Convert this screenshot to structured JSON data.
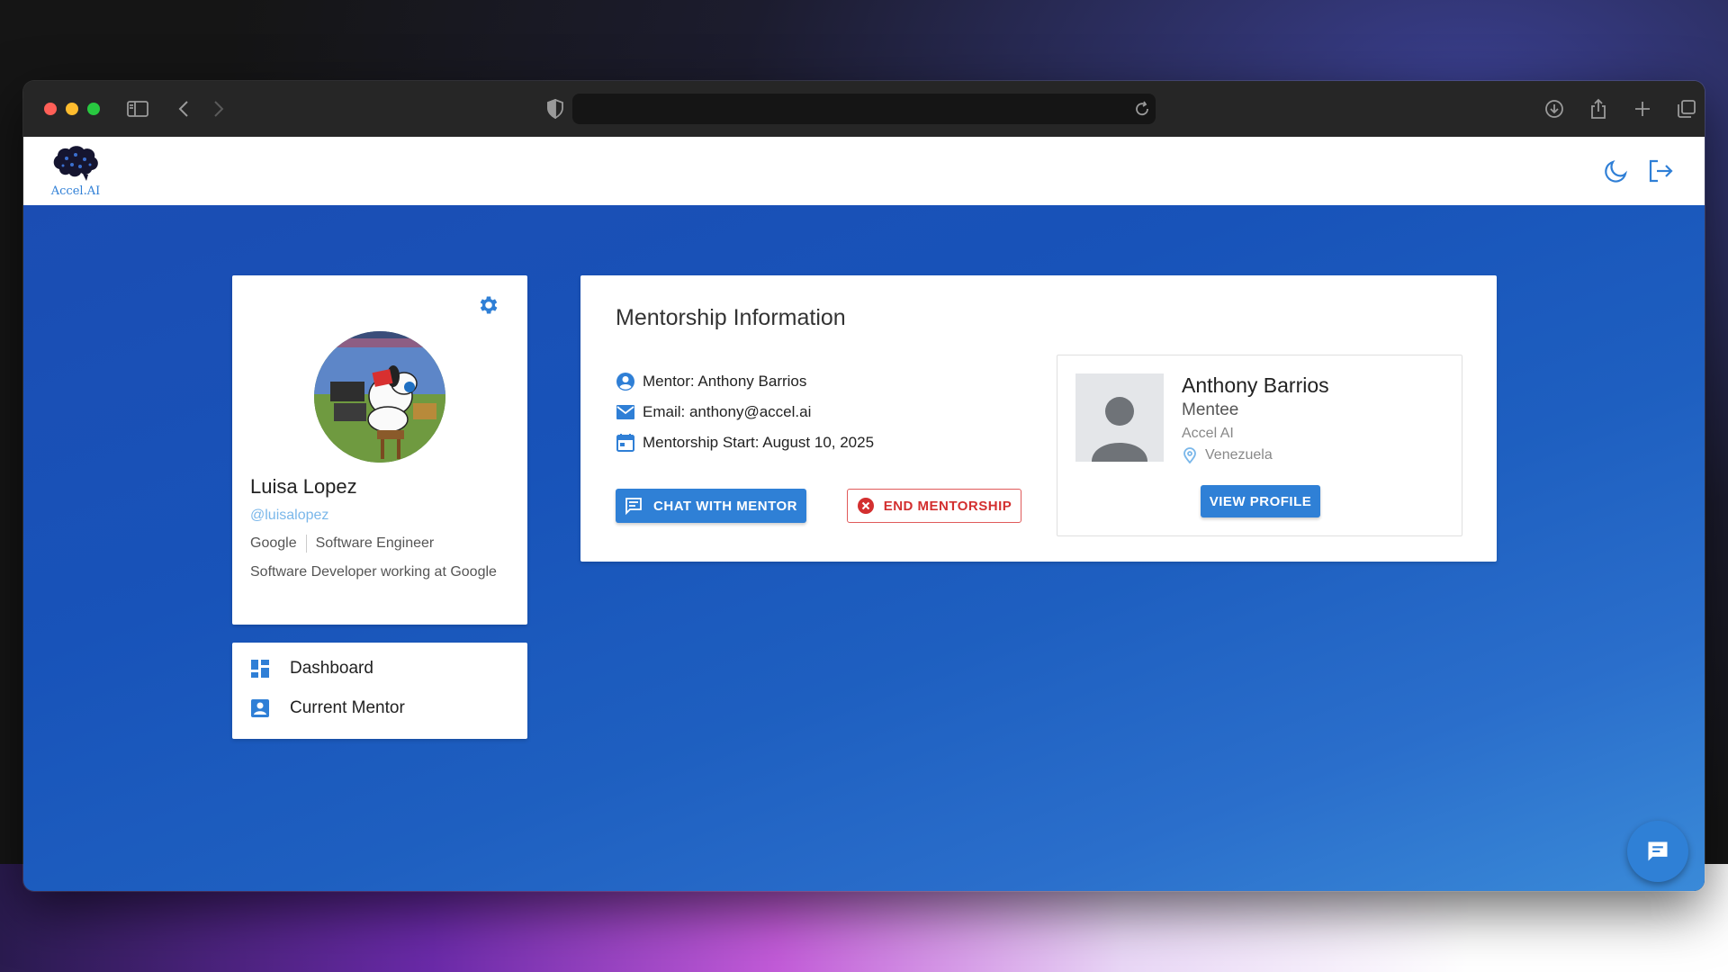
{
  "browser": {
    "traffic_colors": [
      "#ff5f57",
      "#febc2e",
      "#28c840"
    ],
    "icons": [
      "sidebar-icon",
      "back-icon",
      "forward-icon",
      "shield-icon",
      "reload-icon",
      "download-icon",
      "share-icon",
      "plus-icon",
      "tabs-icon"
    ]
  },
  "app": {
    "logo_text": "Accel.AI",
    "accent": "#2f80d6"
  },
  "profile": {
    "name": "Luisa Lopez",
    "handle": "@luisalopez",
    "company": "Google",
    "title": "Software Engineer",
    "bio": "Software Developer working at Google"
  },
  "nav": {
    "items": [
      {
        "label": "Dashboard",
        "icon": "dashboard-icon"
      },
      {
        "label": "Current Mentor",
        "icon": "person-badge-icon"
      }
    ]
  },
  "mentorship": {
    "title": "Mentorship Information",
    "mentor_line": "Mentor: Anthony Barrios",
    "email_line": "Email: anthony@accel.ai",
    "start_line": "Mentorship Start: August 10, 2025",
    "chat_button": "CHAT WITH MENTOR",
    "end_button": "END MENTORSHIP"
  },
  "mentor_card": {
    "name": "Anthony Barrios",
    "role": "Mentee",
    "company": "Accel AI",
    "location": "Venezuela",
    "view_button": "VIEW PROFILE"
  }
}
